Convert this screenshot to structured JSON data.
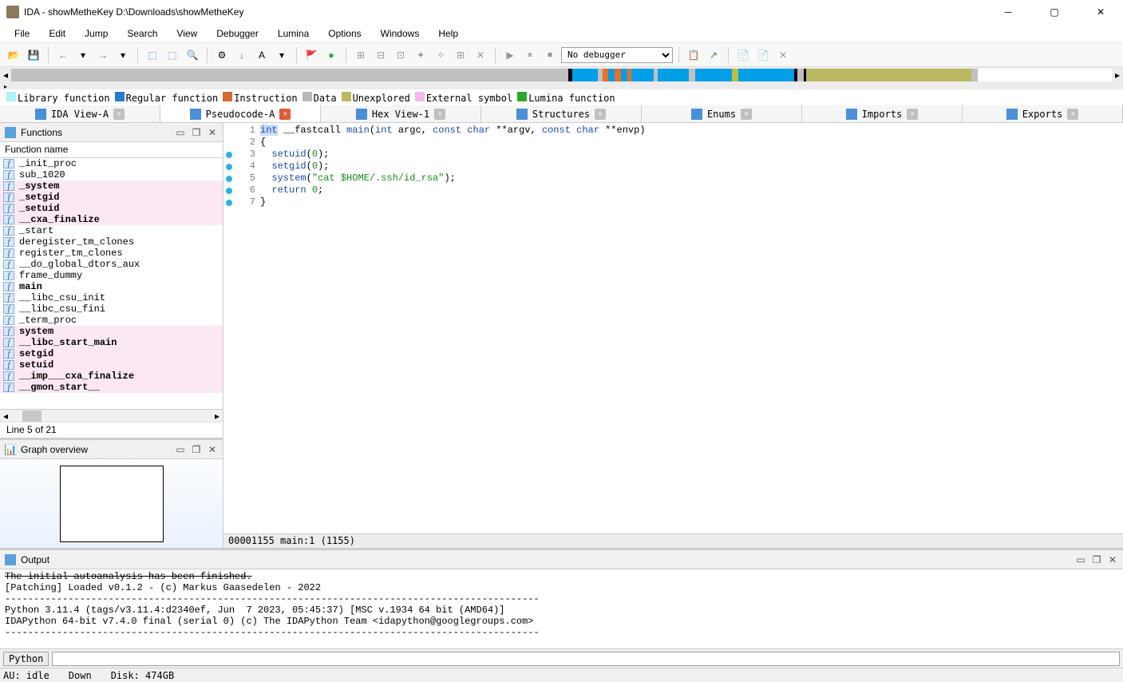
{
  "window": {
    "title": "IDA - showMetheKey D:\\Downloads\\showMetheKey"
  },
  "menu": [
    "File",
    "Edit",
    "Jump",
    "Search",
    "View",
    "Debugger",
    "Lumina",
    "Options",
    "Windows",
    "Help"
  ],
  "debugger_select": "No debugger",
  "nav_segments": [
    {
      "color": "#c0c0c0",
      "width": 54
    },
    {
      "color": "#000000",
      "width": 0.4
    },
    {
      "color": "#009fe8",
      "width": 2.5
    },
    {
      "color": "#c0c0c0",
      "width": 0.4
    },
    {
      "color": "#e87028",
      "width": 0.6
    },
    {
      "color": "#009fe8",
      "width": 0.6
    },
    {
      "color": "#e87028",
      "width": 0.6
    },
    {
      "color": "#009fe8",
      "width": 0.6
    },
    {
      "color": "#e87028",
      "width": 0.4
    },
    {
      "color": "#009fe8",
      "width": 2.2
    },
    {
      "color": "#c0c0c0",
      "width": 0.4
    },
    {
      "color": "#009fe8",
      "width": 3
    },
    {
      "color": "#c0c0c0",
      "width": 0.6
    },
    {
      "color": "#009fe8",
      "width": 3.6
    },
    {
      "color": "#bcc040",
      "width": 0.6
    },
    {
      "color": "#009fe8",
      "width": 5.4
    },
    {
      "color": "#000000",
      "width": 0.3
    },
    {
      "color": "#c0c0c0",
      "width": 0.6
    },
    {
      "color": "#000000",
      "width": 0.3
    },
    {
      "color": "#bab860",
      "width": 16
    },
    {
      "color": "#c0c0c0",
      "width": 0.6
    },
    {
      "color": "#ffffff",
      "width": 13
    }
  ],
  "legend": [
    {
      "color": "#aef0f6",
      "label": "Library function"
    },
    {
      "color": "#2a7acc",
      "label": "Regular function"
    },
    {
      "color": "#d86a30",
      "label": "Instruction"
    },
    {
      "color": "#b8b8b8",
      "label": "Data"
    },
    {
      "color": "#bab860",
      "label": "Unexplored"
    },
    {
      "color": "#f6b8e6",
      "label": "External symbol"
    },
    {
      "color": "#2aa82a",
      "label": "Lumina function"
    }
  ],
  "tabs": [
    {
      "label": "IDA View-A",
      "active": false
    },
    {
      "label": "Pseudocode-A",
      "active": true
    },
    {
      "label": "Hex View-1",
      "active": false
    },
    {
      "label": "Structures",
      "active": false
    },
    {
      "label": "Enums",
      "active": false
    },
    {
      "label": "Imports",
      "active": false
    },
    {
      "label": "Exports",
      "active": false
    }
  ],
  "functions_panel": {
    "title": "Functions",
    "column": "Function name",
    "line_info": "Line 5 of 21",
    "rows": [
      {
        "name": "_init_proc",
        "pink": false,
        "bold": false
      },
      {
        "name": "sub_1020",
        "pink": false,
        "bold": false
      },
      {
        "name": "_system",
        "pink": true,
        "bold": true
      },
      {
        "name": "_setgid",
        "pink": true,
        "bold": true
      },
      {
        "name": "_setuid",
        "pink": true,
        "bold": true
      },
      {
        "name": "__cxa_finalize",
        "pink": true,
        "bold": true
      },
      {
        "name": "_start",
        "pink": false,
        "bold": false
      },
      {
        "name": "deregister_tm_clones",
        "pink": false,
        "bold": false
      },
      {
        "name": "register_tm_clones",
        "pink": false,
        "bold": false
      },
      {
        "name": "__do_global_dtors_aux",
        "pink": false,
        "bold": false
      },
      {
        "name": "frame_dummy",
        "pink": false,
        "bold": false
      },
      {
        "name": "main",
        "pink": false,
        "bold": true
      },
      {
        "name": "__libc_csu_init",
        "pink": false,
        "bold": false
      },
      {
        "name": "__libc_csu_fini",
        "pink": false,
        "bold": false
      },
      {
        "name": "_term_proc",
        "pink": false,
        "bold": false
      },
      {
        "name": "system",
        "pink": true,
        "bold": true
      },
      {
        "name": "__libc_start_main",
        "pink": true,
        "bold": true
      },
      {
        "name": "setgid",
        "pink": true,
        "bold": true
      },
      {
        "name": "setuid",
        "pink": true,
        "bold": true
      },
      {
        "name": "__imp___cxa_finalize",
        "pink": true,
        "bold": true
      },
      {
        "name": "__gmon_start__",
        "pink": true,
        "bold": true
      }
    ]
  },
  "graph_panel": {
    "title": "Graph overview"
  },
  "code": {
    "lines": [
      {
        "n": 1,
        "dot": false,
        "html": "<span class='hl'><span class='kw'>int</span></span> __fastcall <span class='fn'>main</span>(<span class='kw'>int</span> argc, <span class='kw'>const char</span> **argv, <span class='kw'>const char</span> **envp)"
      },
      {
        "n": 2,
        "dot": false,
        "html": "{"
      },
      {
        "n": 3,
        "dot": true,
        "html": "  <span class='fn'>setuid</span>(<span class='num'>0</span>);"
      },
      {
        "n": 4,
        "dot": true,
        "html": "  <span class='fn'>setgid</span>(<span class='num'>0</span>);"
      },
      {
        "n": 5,
        "dot": true,
        "html": "  <span class='fn'>system</span>(<span class='str'>\"cat $HOME/.ssh/id_rsa\"</span>);"
      },
      {
        "n": 6,
        "dot": true,
        "html": "  <span class='kw'>return</span> <span class='num'>0</span>;"
      },
      {
        "n": 7,
        "dot": true,
        "html": "}"
      }
    ],
    "status": "00001155 main:1 (1155)"
  },
  "output": {
    "title": "Output",
    "text": "The initial autoanalysis has been finished.\n[Patching] Loaded v0.1.2 - (c) Markus Gaasedelen - 2022\n---------------------------------------------------------------------------------------------\nPython 3.11.4 (tags/v3.11.4:d2340ef, Jun  7 2023, 05:45:37) [MSC v.1934 64 bit (AMD64)]\nIDAPython 64-bit v7.4.0 final (serial 0) (c) The IDAPython Team <idapython@googlegroups.com>\n---------------------------------------------------------------------------------------------",
    "prompt_label": "Python"
  },
  "statusbar": {
    "au": "AU:  idle",
    "down": "Down",
    "disk": "Disk: 474GB"
  }
}
